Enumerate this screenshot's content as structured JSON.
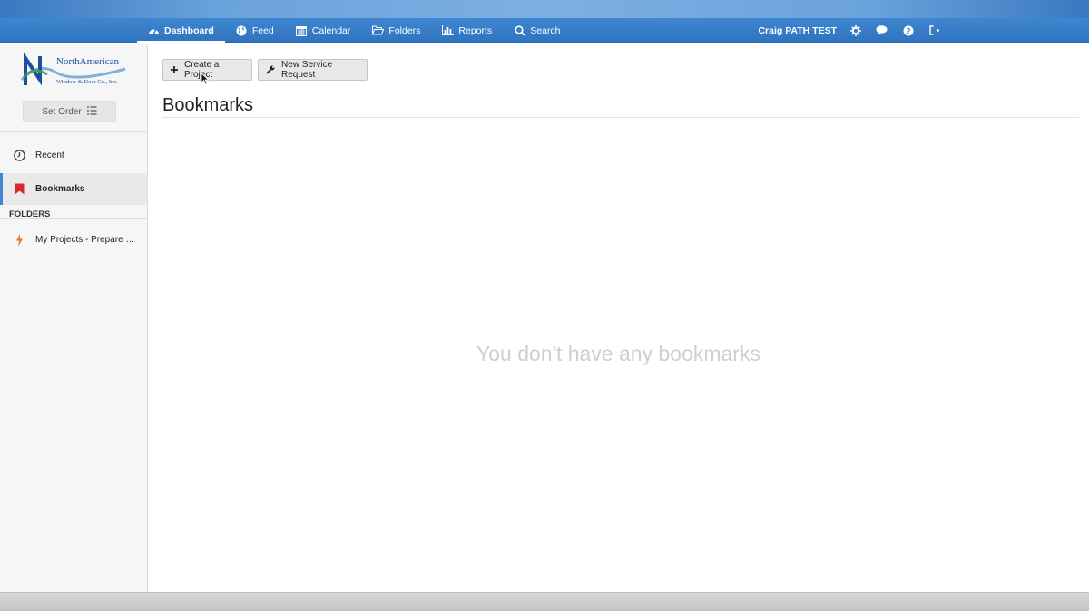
{
  "app": {
    "brand_logo_line1": "NorthAmerican",
    "brand_logo_line2": "Window & Door Co., Inc."
  },
  "nav": {
    "items": [
      {
        "label": "Dashboard",
        "icon": "dashboard-icon",
        "active": true
      },
      {
        "label": "Feed",
        "icon": "globe-icon",
        "active": false
      },
      {
        "label": "Calendar",
        "icon": "calendar-icon",
        "active": false
      },
      {
        "label": "Folders",
        "icon": "folder-open-icon",
        "active": false
      },
      {
        "label": "Reports",
        "icon": "bar-chart-icon",
        "active": false
      },
      {
        "label": "Search",
        "icon": "search-icon",
        "active": false
      }
    ],
    "user_name": "Craig PATH TEST",
    "user_icons": [
      "gear-icon",
      "comment-icon",
      "help-icon",
      "sign-out-icon"
    ]
  },
  "sidebar": {
    "set_order_label": "Set Order",
    "items": [
      {
        "label": "Recent",
        "icon": "clock-icon"
      },
      {
        "label": "Bookmarks",
        "icon": "bookmark-icon",
        "active": true
      }
    ],
    "folders_heading": "FOLDERS",
    "folders": [
      {
        "label": "My Projects - Prepare Ord...",
        "icon": "bolt-icon"
      }
    ]
  },
  "main": {
    "buttons": {
      "create_project": "Create a Project",
      "new_service_request": "New Service Request"
    },
    "title": "Bookmarks",
    "empty_message": "You don't have any bookmarks"
  },
  "colors": {
    "nav_bar": "#2f74c0",
    "active_accent": "#3f86d0",
    "bookmark_icon": "#d42c2c",
    "bolt_icon": "#e8762c",
    "logo_blue": "#1c4f9c",
    "logo_green": "#3aa04a"
  }
}
